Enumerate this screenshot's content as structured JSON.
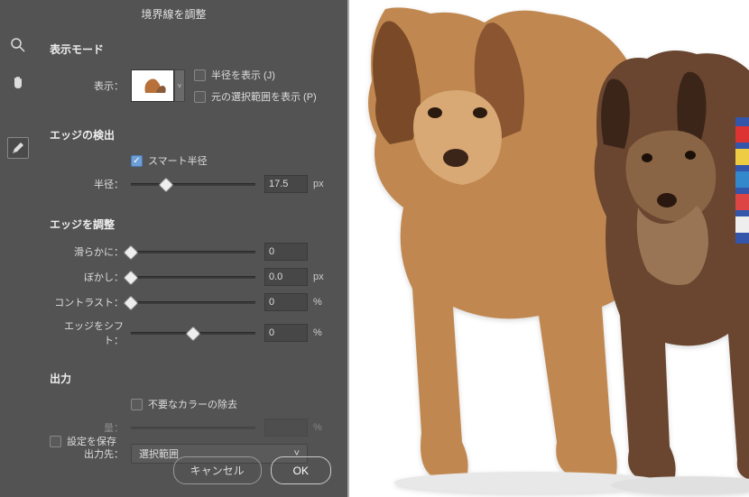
{
  "title": "境界線を調整",
  "sections": {
    "view_mode": "表示モード",
    "edge_detect": "エッジの検出",
    "edge_adjust": "エッジを調整",
    "output": "出力"
  },
  "labels": {
    "show": "表示：",
    "show_radius": "半径を表示 (J)",
    "show_original": "元の選択範囲を表示 (P)",
    "smart_radius": "スマート半径",
    "radius": "半径：",
    "smooth": "滑らかに：",
    "feather": "ぼかし：",
    "contrast": "コントラスト：",
    "shift_edge": "エッジをシフト：",
    "decontaminate": "不要なカラーの除去",
    "amount": "量：",
    "output_to": "出力先：",
    "save_settings": "設定を保存"
  },
  "values": {
    "radius": "17.5",
    "smooth": "0",
    "feather": "0.0",
    "contrast": "0",
    "shift_edge": "0",
    "amount": "",
    "output_select": "選択範囲"
  },
  "units": {
    "px": "px",
    "pct": "%"
  },
  "buttons": {
    "cancel": "キャンセル",
    "ok": "OK"
  },
  "slider_positions": {
    "radius": 28,
    "smooth": 0,
    "feather": 0,
    "contrast": 0,
    "shift_edge": 50
  }
}
